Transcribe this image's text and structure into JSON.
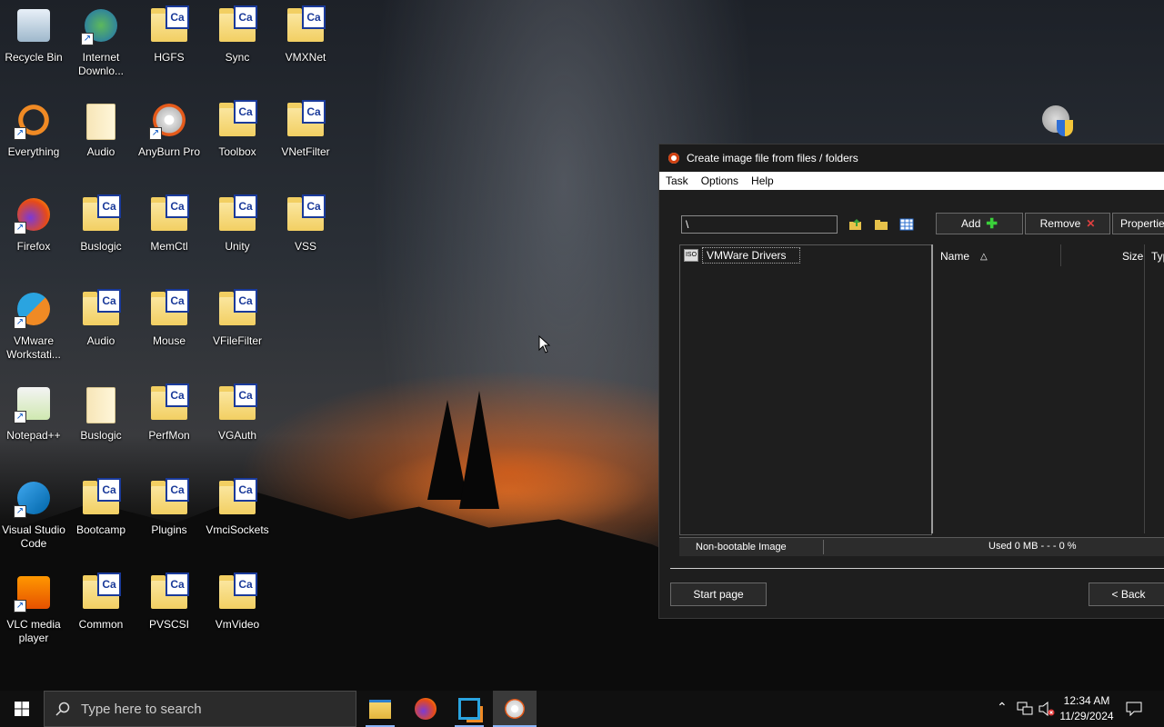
{
  "desktop_icons": [
    {
      "label": "Recycle Bin",
      "icon": "recycle-bin-icon"
    },
    {
      "label": "Internet Downlo...",
      "icon": "idm-icon"
    },
    {
      "label": "HGFS",
      "icon": "folder-icon"
    },
    {
      "label": "Sync",
      "icon": "folder-icon"
    },
    {
      "label": "VMXNet",
      "icon": "folder-icon"
    },
    {
      "label": "Everything",
      "icon": "everything-icon"
    },
    {
      "label": "Audio",
      "icon": "folder-icon"
    },
    {
      "label": "AnyBurn Pro",
      "icon": "anyburn-icon"
    },
    {
      "label": "Toolbox",
      "icon": "folder-icon"
    },
    {
      "label": "VNetFilter",
      "icon": "folder-icon"
    },
    {
      "label": "Firefox",
      "icon": "firefox-icon"
    },
    {
      "label": "Buslogic",
      "icon": "folder-icon"
    },
    {
      "label": "MemCtl",
      "icon": "folder-icon"
    },
    {
      "label": "Unity",
      "icon": "folder-icon"
    },
    {
      "label": "VSS",
      "icon": "folder-icon"
    },
    {
      "label": "VMware Workstati...",
      "icon": "vmware-icon"
    },
    {
      "label": "Audio",
      "icon": "folder-icon"
    },
    {
      "label": "Mouse",
      "icon": "folder-icon"
    },
    {
      "label": "VFileFilter",
      "icon": "folder-icon"
    },
    {
      "label": "Notepad++",
      "icon": "notepadpp-icon"
    },
    {
      "label": "Buslogic",
      "icon": "folder-icon"
    },
    {
      "label": "PerfMon",
      "icon": "folder-icon"
    },
    {
      "label": "VGAuth",
      "icon": "folder-icon"
    },
    {
      "label": "Visual Studio Code",
      "icon": "vscode-icon"
    },
    {
      "label": "Bootcamp",
      "icon": "folder-icon"
    },
    {
      "label": "Plugins",
      "icon": "folder-icon"
    },
    {
      "label": "VmciSockets",
      "icon": "folder-icon"
    },
    {
      "label": "VLC media player",
      "icon": "vlc-icon"
    },
    {
      "label": "Common",
      "icon": "folder-icon"
    },
    {
      "label": "PVSCSI",
      "icon": "folder-icon"
    },
    {
      "label": "VmVideo",
      "icon": "folder-icon"
    }
  ],
  "folder_badge": "Ca",
  "dialog": {
    "title": "Create image file from files / folders",
    "menu": [
      "Task",
      "Options",
      "Help"
    ],
    "path": "\\",
    "buttons": {
      "add": "Add",
      "remove": "Remove",
      "properties": "Propertie"
    },
    "tree_item": "VMWare Drivers",
    "columns": {
      "name": "Name",
      "size": "Size",
      "type": "Typ"
    },
    "status": {
      "boot": "Non-bootable Image",
      "used": "Used  0 MB   - - -  0 %"
    },
    "footer": {
      "start": "Start page",
      "back": "< Back"
    }
  },
  "taskbar": {
    "search_placeholder": "Type here to search",
    "time": "12:34 AM",
    "date": "11/29/2024"
  }
}
